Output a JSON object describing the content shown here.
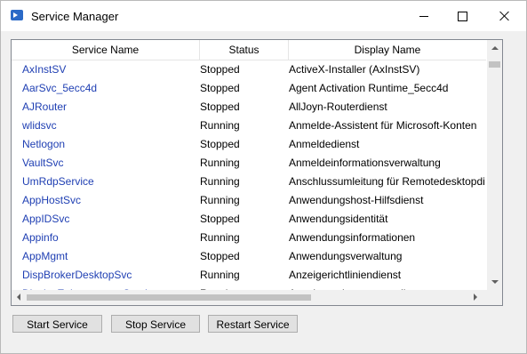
{
  "window": {
    "title": "Service Manager"
  },
  "grid": {
    "columns": [
      "Service Name",
      "Status",
      "Display Name"
    ],
    "rows": [
      [
        "AxInstSV",
        "Stopped",
        "ActiveX-Installer (AxInstSV)"
      ],
      [
        "AarSvc_5ecc4d",
        "Stopped",
        "Agent Activation Runtime_5ecc4d"
      ],
      [
        "AJRouter",
        "Stopped",
        "AllJoyn-Routerdienst"
      ],
      [
        "wlidsvc",
        "Running",
        "Anmelde-Assistent für Microsoft-Konten"
      ],
      [
        "Netlogon",
        "Stopped",
        "Anmeldedienst"
      ],
      [
        "VaultSvc",
        "Running",
        "Anmeldeinformationsverwaltung"
      ],
      [
        "UmRdpService",
        "Running",
        "Anschlussumleitung für Remotedesktopdi"
      ],
      [
        "AppHostSvc",
        "Running",
        "Anwendungshost-Hilfsdienst"
      ],
      [
        "AppIDSvc",
        "Stopped",
        "Anwendungsidentität"
      ],
      [
        "Appinfo",
        "Running",
        "Anwendungsinformationen"
      ],
      [
        "AppMgmt",
        "Stopped",
        "Anwendungsverwaltung"
      ],
      [
        "DispBrokerDesktopSvc",
        "Running",
        "Anzeigerichtliniendienst"
      ],
      [
        "DisplayEnhancementService",
        "Running",
        "Anzeigeverbesserungsdienst"
      ]
    ]
  },
  "buttons": {
    "start": "Start Service",
    "stop": "Stop Service",
    "restart": "Restart Service"
  },
  "colors": {
    "link": "#1f3fb3",
    "accent": "#2b6ac7"
  }
}
